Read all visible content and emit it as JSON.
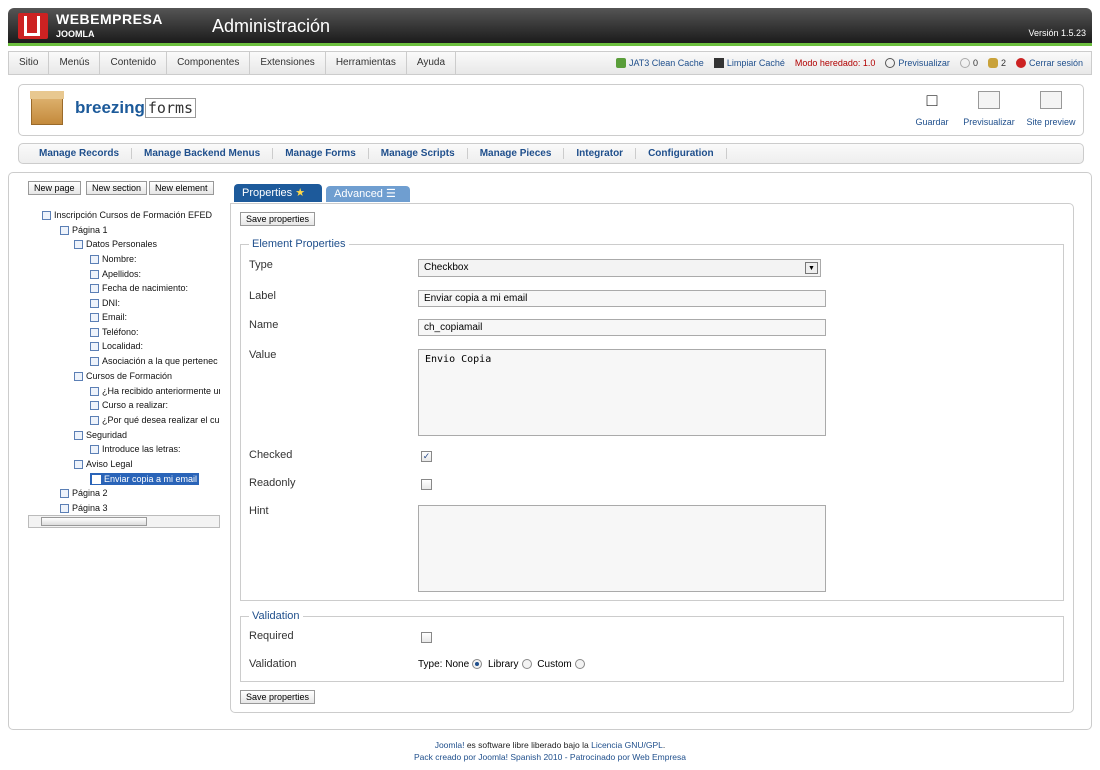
{
  "header": {
    "brand_line1": "WEBEMPRESA",
    "brand_line2": "JOOMLA",
    "title": "Administración",
    "version": "Versión 1.5.23"
  },
  "menu": {
    "items": [
      "Sitio",
      "Menús",
      "Contenido",
      "Componentes",
      "Extensiones",
      "Herramientas",
      "Ayuda"
    ]
  },
  "status": {
    "cache": "JAT3 Clean Cache",
    "clear_cache": "Limpiar Caché",
    "mode": "Modo heredado: 1.0",
    "preview": "Previsualizar",
    "messages": "0",
    "users": "2",
    "logout": "Cerrar sesión"
  },
  "component": {
    "name_bold": "breezing",
    "name_mono": "forms"
  },
  "toolbar": {
    "save": "Guardar",
    "preview": "Previsualizar",
    "site_preview": "Site preview"
  },
  "subnav": [
    "Manage Records",
    "Manage Backend Menus",
    "Manage Forms",
    "Manage Scripts",
    "Manage Pieces",
    "Integrator",
    "Configuration"
  ],
  "tree_buttons": {
    "new_page": "New page",
    "new_section": "New section",
    "new_element": "New element"
  },
  "tree": [
    {
      "label": "Inscripción Cursos de Formación EFED",
      "indent": 0
    },
    {
      "label": "Página 1",
      "indent": 1
    },
    {
      "label": "Datos Personales",
      "indent": 2
    },
    {
      "label": "Nombre:",
      "indent": 3
    },
    {
      "label": "Apellidos:",
      "indent": 3
    },
    {
      "label": "Fecha de nacimiento:",
      "indent": 3
    },
    {
      "label": "DNI:",
      "indent": 3
    },
    {
      "label": "Email:",
      "indent": 3
    },
    {
      "label": "Teléfono:",
      "indent": 3
    },
    {
      "label": "Localidad:",
      "indent": 3
    },
    {
      "label": "Asociación a la que pertenec",
      "indent": 3
    },
    {
      "label": "Cursos de Formación",
      "indent": 2
    },
    {
      "label": "¿Ha recibido anteriormente ur",
      "indent": 3
    },
    {
      "label": "Curso a realizar:",
      "indent": 3
    },
    {
      "label": "¿Por qué desea realizar el cu",
      "indent": 3
    },
    {
      "label": "Seguridad",
      "indent": 2
    },
    {
      "label": "Introduce las letras:",
      "indent": 3
    },
    {
      "label": "Aviso Legal",
      "indent": 2
    },
    {
      "label": "Enviar copia a mi email",
      "indent": 3,
      "selected": true
    },
    {
      "label": "Página 2",
      "indent": 1
    },
    {
      "label": "Página 3",
      "indent": 1
    }
  ],
  "tabs": {
    "properties": "Properties",
    "advanced": "Advanced"
  },
  "form": {
    "save_label": "Save properties",
    "element_legend": "Element Properties",
    "type_label": "Type",
    "type_value": "Checkbox",
    "label_label": "Label",
    "label_value": "Enviar copia a mi email",
    "name_label": "Name",
    "name_value": "ch_copiamail",
    "value_label": "Value",
    "value_value": "Envio Copia",
    "checked_label": "Checked",
    "checked": true,
    "readonly_label": "Readonly",
    "readonly": false,
    "hint_label": "Hint",
    "hint_value": "",
    "validation_legend": "Validation",
    "required_label": "Required",
    "required": false,
    "validation_label": "Validation",
    "validation_type_prefix": "Type: None",
    "validation_library": "Library",
    "validation_custom": "Custom"
  },
  "footer": {
    "line1_a": "Joomla!",
    "line1_b": " es software libre liberado bajo la ",
    "line1_c": "Licencia GNU/GPL",
    "line1_d": ".",
    "line2": "Pack creado por Joomla! Spanish 2010 - Patrocinado por Web Empresa"
  }
}
